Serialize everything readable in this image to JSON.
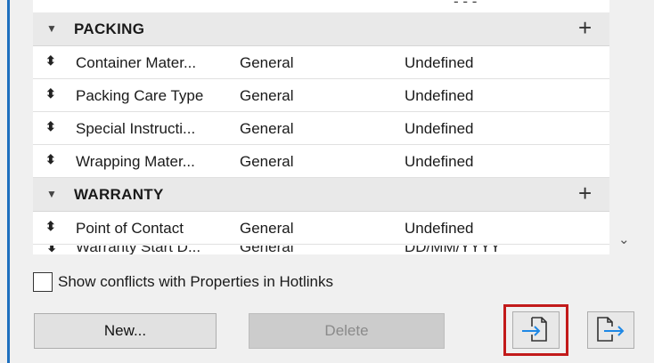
{
  "groups": [
    {
      "label": "PACKING",
      "properties": [
        {
          "name": "Container Mater...",
          "type": "General",
          "value": "Undefined"
        },
        {
          "name": "Packing Care Type",
          "type": "General",
          "value": "Undefined"
        },
        {
          "name": "Special Instructi...",
          "type": "General",
          "value": "Undefined"
        },
        {
          "name": "Wrapping Mater...",
          "type": "General",
          "value": "Undefined"
        }
      ]
    },
    {
      "label": "WARRANTY",
      "properties": [
        {
          "name": "Point of Contact",
          "type": "General",
          "value": "Undefined"
        },
        {
          "name": "Warranty Start D...",
          "type": "General",
          "value": "DD/MM/YYYY"
        }
      ]
    }
  ],
  "icons": {
    "collapse": "triangle-down-icon",
    "add": "plus-icon",
    "drag": "drag-handle-icon",
    "scroll": "chevron-down-icon",
    "import": "import-icon",
    "export": "export-icon"
  },
  "glyphs": {
    "collapse": "▼",
    "add": "+",
    "drag": "⬍",
    "scroll": "⌄"
  },
  "checkbox": {
    "label": "Show conflicts with Properties in Hotlinks",
    "checked": false
  },
  "buttons": {
    "new": "New...",
    "delete": "Delete"
  },
  "colors": {
    "accent": "#1e6fbf",
    "highlight": "#c21a1a",
    "icon_blue": "#1e88e5"
  }
}
